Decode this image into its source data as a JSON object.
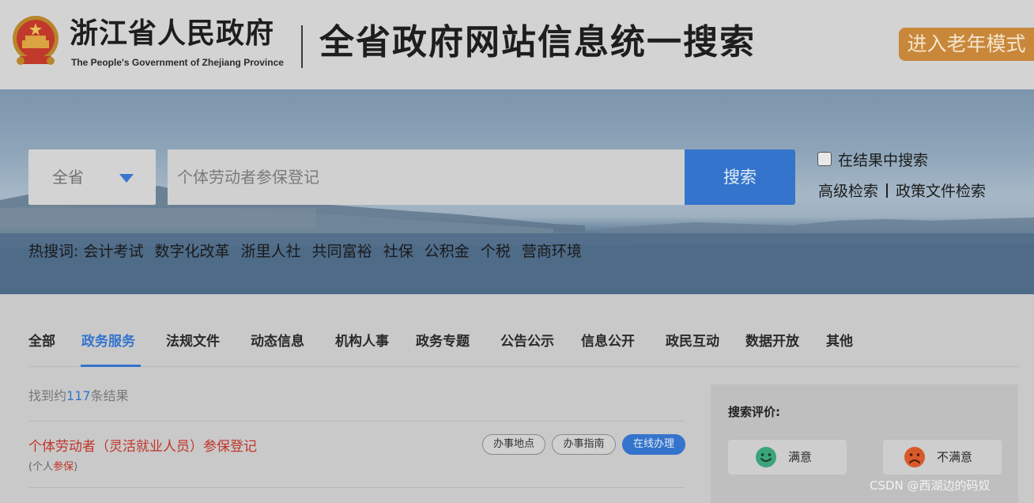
{
  "header": {
    "site_name": "浙江省人民政府",
    "site_name_en": "The People's Government of Zhejiang Province",
    "search_title": "全省政府网站信息统一搜索",
    "elder_mode_label": "进入老年模式"
  },
  "search": {
    "scope_label": "全省",
    "placeholder": "个体劳动者参保登记",
    "button_label": "搜索",
    "within_results_label": "在结果中搜索",
    "advanced_search_label": "高级检索",
    "policy_search_label": "政策文件检索"
  },
  "hot_words": {
    "label": "热搜词:",
    "items": [
      "会计考试",
      "数字化改革",
      "浙里人社",
      "共同富裕",
      "社保",
      "公积金",
      "个税",
      "营商环境"
    ]
  },
  "tabs": {
    "items": [
      "全部",
      "政务服务",
      "法规文件",
      "动态信息",
      "机构人事",
      "政务专题",
      "公告公示",
      "信息公开",
      "政民互动",
      "数据开放",
      "其他"
    ],
    "active": "政务服务"
  },
  "results": {
    "count_prefix": "找到约",
    "count": "117",
    "count_suffix": "条结果",
    "items": [
      {
        "title": "个体劳动者（灵活就业人员）参保登记",
        "sub_open": "(",
        "sub_plain": "个人",
        "sub_highlight": "参保",
        "sub_close": ")",
        "actions": [
          "办事地点",
          "办事指南",
          "在线办理"
        ]
      }
    ]
  },
  "rating": {
    "title": "搜索评价:",
    "satisfied_label": "满意",
    "unsatisfied_label": "不满意"
  },
  "watermark": "CSDN @西湖边的码奴",
  "colors": {
    "accent": "#3474cc",
    "result_title": "#c0342a",
    "elder_button": "#c9873a",
    "satisfied_face": "#3aa57a",
    "unsatisfied_face": "#d85a2a"
  }
}
